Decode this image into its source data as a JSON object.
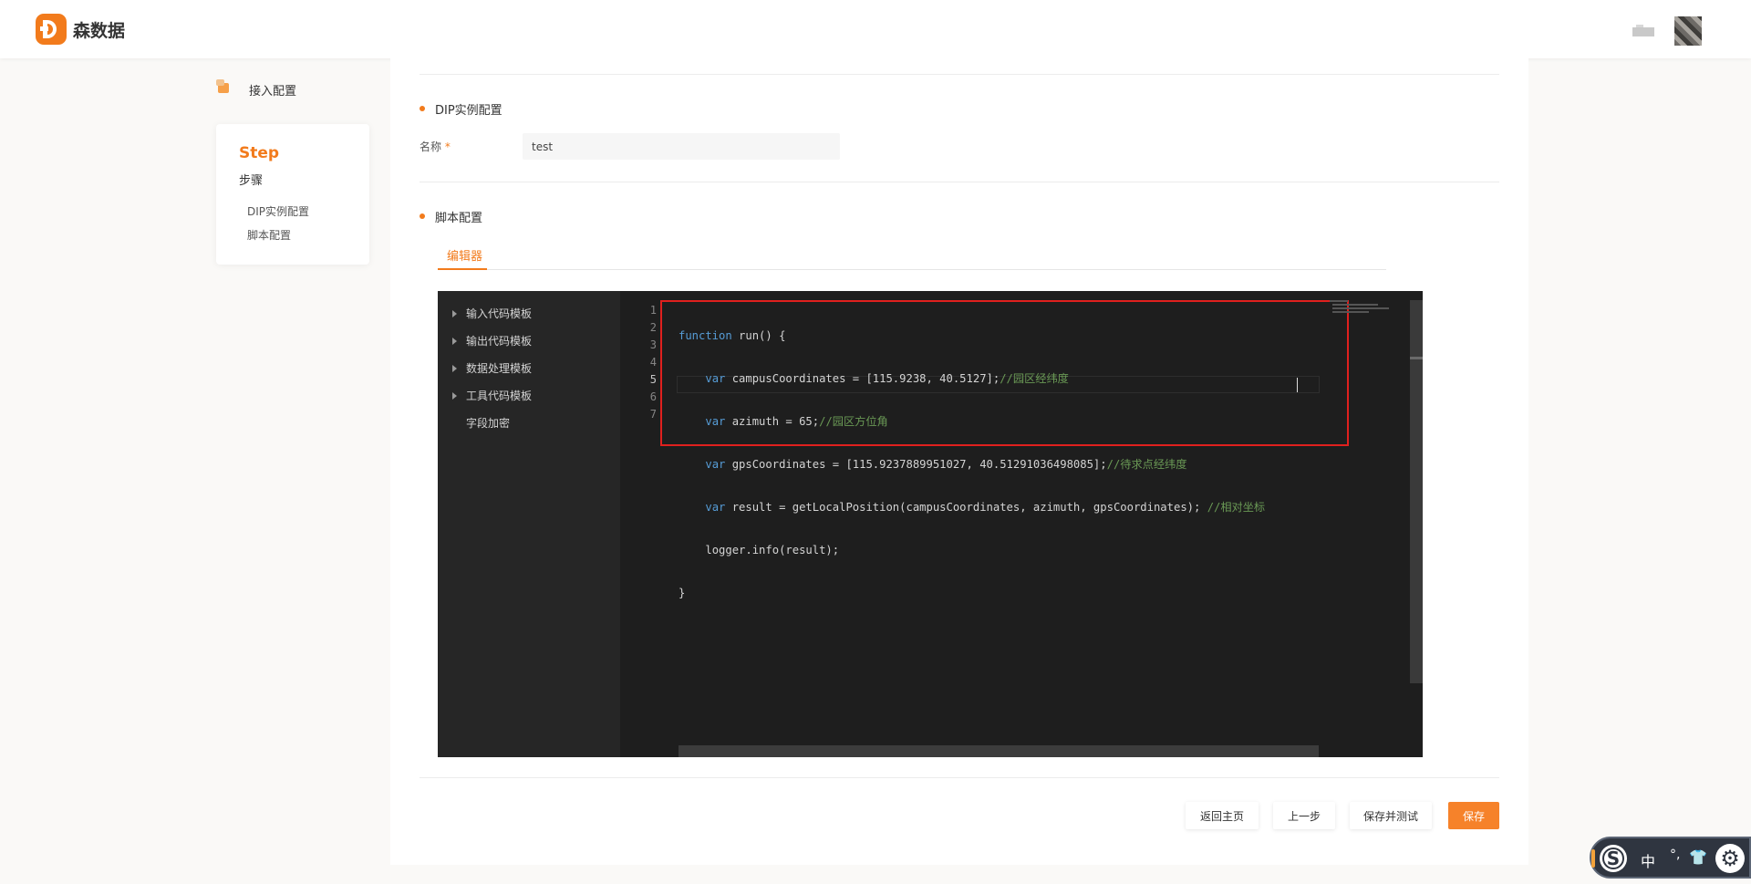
{
  "header": {
    "brand": "森数据"
  },
  "sidebar": {
    "access_label": "接入配置",
    "step_title": "Step",
    "step_subtitle": "步骤",
    "items": [
      {
        "label": "DIP实例配置"
      },
      {
        "label": "脚本配置"
      }
    ]
  },
  "dip_section": {
    "title": "DIP实例配置",
    "name_label": "名称",
    "required_mark": "*",
    "name_value": "test"
  },
  "script_section": {
    "title": "脚本配置",
    "tab_label": "编辑器"
  },
  "editor": {
    "tree": [
      {
        "label": "输入代码模板"
      },
      {
        "label": "输出代码模板"
      },
      {
        "label": "数据处理模板"
      },
      {
        "label": "工具代码模板"
      },
      {
        "label": "字段加密"
      }
    ],
    "line_numbers": [
      "1",
      "2",
      "3",
      "4",
      "5",
      "6",
      "7"
    ],
    "current_line": 5,
    "code": {
      "l1_kw": "function",
      "l1_rest": " run() {",
      "l2_kw": "var",
      "l2_rest": " campusCoordinates = [115.9238, 40.5127];",
      "l2_comment": "//园区经纬度",
      "l3_kw": "var",
      "l3_rest": " azimuth = 65;",
      "l3_comment": "//园区方位角",
      "l4_kw": "var",
      "l4_rest": " gpsCoordinates = [115.9237889951027, 40.51291036498085];",
      "l4_comment": "//待求点经纬度",
      "l5_kw": "var",
      "l5_rest": " result = getLocalPosition(campusCoordinates, azimuth, gpsCoordinates); ",
      "l5_comment": "//相对坐标",
      "l6": "logger.info(result);",
      "l7": "}"
    }
  },
  "buttons": {
    "back_home": "返回主页",
    "prev_step": "上一步",
    "save_test": "保存并测试",
    "save": "保存"
  },
  "ime": {
    "logo": "S",
    "mode": "中",
    "punct": "°,",
    "skin": "👕",
    "settings": "⚙"
  },
  "colors": {
    "accent": "#f27b1c",
    "highlight_box": "#e0201e",
    "editor_bg": "#1e1e1e"
  }
}
